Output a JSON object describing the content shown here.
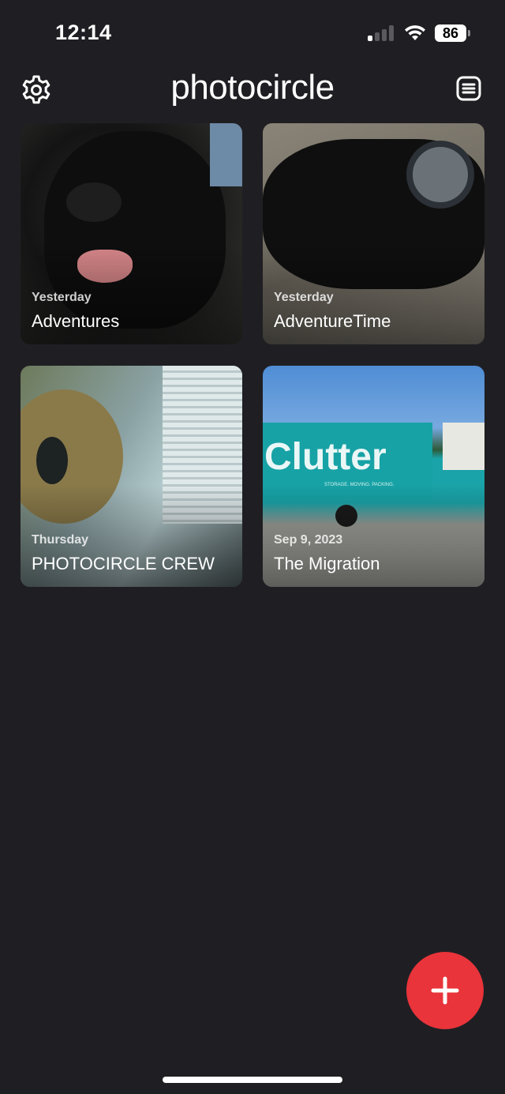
{
  "status_bar": {
    "time": "12:14",
    "battery": "86"
  },
  "header": {
    "logo_light": "photo",
    "logo_bold": "circle",
    "settings_icon": "gear-icon",
    "list_icon": "list-icon"
  },
  "circles": [
    {
      "date": "Yesterday",
      "title": "Adventures",
      "thumbnail": "black labrador face"
    },
    {
      "date": "Yesterday",
      "title": "AdventureTime",
      "thumbnail": "black dog lying on carpet near walker wheel"
    },
    {
      "date": "Thursday",
      "title": "PHOTOCIRCLE CREW",
      "thumbnail": "person playing acoustic guitar by window"
    },
    {
      "date": "Sep 9, 2023",
      "title": "The Migration",
      "thumbnail": "teal moving truck on driveway"
    }
  ],
  "truck_text": "Clutter",
  "truck_subtext": "STORAGE. MOVING. PACKING.",
  "fab": {
    "icon": "plus-icon"
  },
  "colors": {
    "background": "#1f1f23",
    "accent": "#e8343a"
  }
}
